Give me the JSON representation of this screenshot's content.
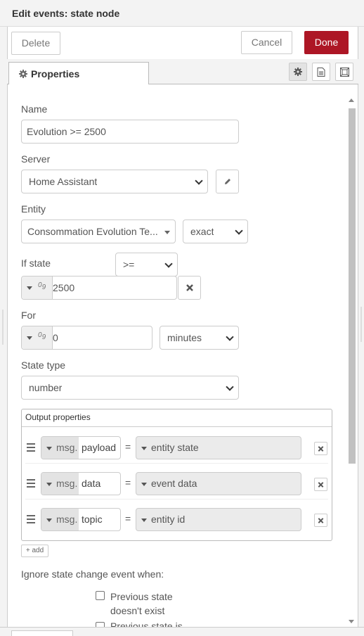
{
  "header": {
    "title": "Edit events: state node"
  },
  "buttons": {
    "delete": "Delete",
    "cancel": "Cancel",
    "done": "Done"
  },
  "tabs": {
    "properties": "Properties"
  },
  "form": {
    "name_label": "Name",
    "name_value": "Evolution >= 2500",
    "server_label": "Server",
    "server_value": "Home Assistant",
    "entity_label": "Entity",
    "entity_value": "Consommation Evolution Te...",
    "entity_match": "exact",
    "ifstate_label": "If state",
    "ifstate_operator": ">=",
    "ifstate_type_glyph": "09",
    "ifstate_value": "2500",
    "for_label": "For",
    "for_type_glyph": "09",
    "for_value": "0",
    "for_unit": "minutes",
    "statetype_label": "State type",
    "statetype_value": "number"
  },
  "output_properties": {
    "title": "Output properties",
    "prefix": "msg.",
    "rows": [
      {
        "property": "payload",
        "value": "entity state"
      },
      {
        "property": "data",
        "value": "event data"
      },
      {
        "property": "topic",
        "value": "entity id"
      }
    ],
    "add_label": "add"
  },
  "ignore": {
    "title": "Ignore state change event when:",
    "options": [
      "Previous state doesn't exist",
      "Previous state is"
    ],
    "option1_line1": "Previous state",
    "option1_line2": "doesn't exist",
    "option2_partial": "Previous state is"
  }
}
